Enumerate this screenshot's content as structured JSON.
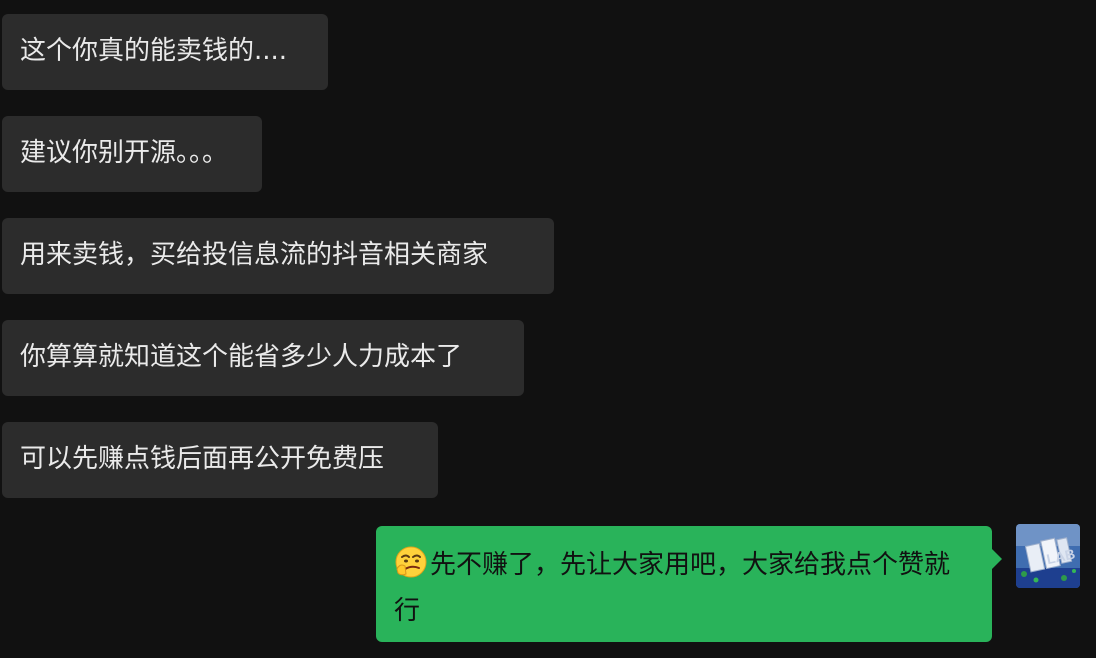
{
  "chat": {
    "incoming_messages": [
      {
        "text": "这个你真的能卖钱的...."
      },
      {
        "text": "建议你别开源。。。"
      },
      {
        "text": "用来卖钱，买给投信息流的抖音相关商家"
      },
      {
        "text": "你算算就知道这个能省多少人力成本了"
      },
      {
        "text": "可以先赚点钱后面再公开免费压"
      }
    ],
    "outgoing_message": {
      "emoji": "smirk-face-emoji",
      "text": "先不赚了，先让大家用吧，大家给我点个赞就行"
    },
    "avatar": {
      "label": "LAB"
    }
  },
  "colors": {
    "background": "#111111",
    "incoming_bubble": "#2c2c2c",
    "outgoing_bubble": "#29b35a",
    "incoming_text": "#eaeaea",
    "outgoing_text": "#111111"
  }
}
